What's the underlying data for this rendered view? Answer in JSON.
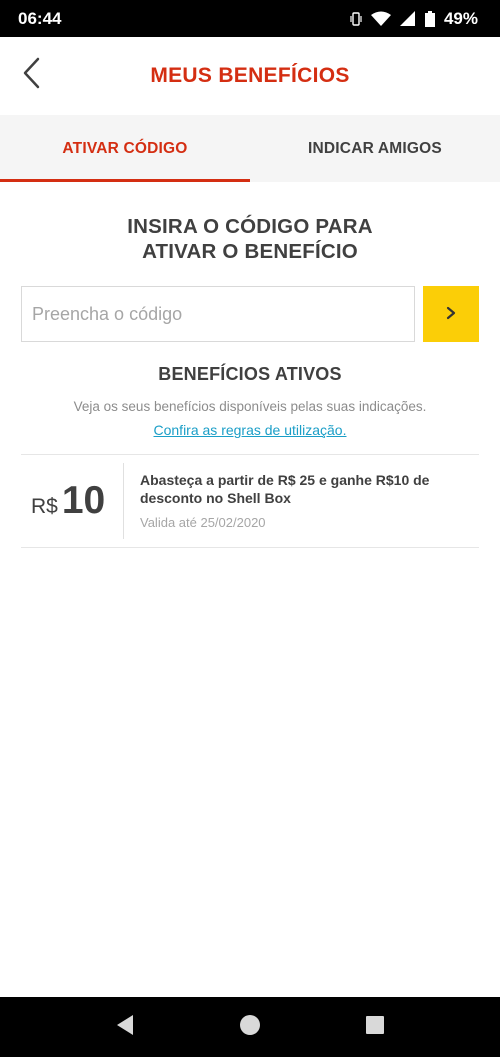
{
  "status_bar": {
    "time": "06:44",
    "battery": "49%",
    "icons": [
      "vibrate-icon",
      "wifi-icon",
      "signal-icon",
      "battery-icon"
    ]
  },
  "header": {
    "title": "MEUS BENEFÍCIOS",
    "back_icon": "chevron-left-icon"
  },
  "tabs": [
    {
      "label": "ATIVAR CÓDIGO",
      "active": true
    },
    {
      "label": "INDICAR AMIGOS",
      "active": false
    }
  ],
  "activate": {
    "heading_line1": "INSIRA O CÓDIGO PARA",
    "heading_line2": "ATIVAR O BENEFÍCIO",
    "input_placeholder": "Preencha o código",
    "input_value": "",
    "submit_icon": "chevron-right-icon"
  },
  "active_benefits": {
    "title": "BENEFÍCIOS ATIVOS",
    "description": "Veja os seus benefícios disponíveis pelas suas indicações.",
    "rules_link": "Confira as regras de utilização.",
    "items": [
      {
        "currency": "R$",
        "value": "10",
        "description": "Abasteça a partir de R$ 25 e ganhe R$10 de desconto no Shell Box",
        "validity": "Valida até 25/02/2020"
      }
    ]
  },
  "nav_bar": {
    "icons": [
      "back-triangle-icon",
      "home-circle-icon",
      "recents-square-icon"
    ]
  },
  "colors": {
    "brand_red": "#d42e12",
    "brand_yellow": "#fbce07",
    "link_blue": "#1a9ec7",
    "text_dark": "#404040"
  }
}
